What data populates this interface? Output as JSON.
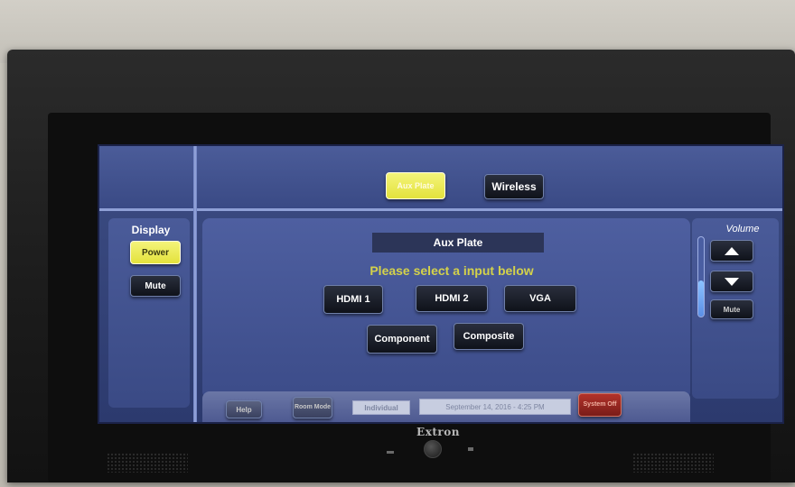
{
  "top": {
    "aux_plate_label": "Aux Plate",
    "wireless_label": "Wireless"
  },
  "left": {
    "display_label": "Display",
    "power_label": "Power",
    "mute_label": "Mute"
  },
  "main": {
    "title": "Aux Plate",
    "prompt": "Please select a input below",
    "inputs": {
      "hdmi1": "HDMI 1",
      "hdmi2": "HDMI 2",
      "vga": "VGA",
      "component": "Component",
      "composite": "Composite"
    }
  },
  "right": {
    "volume_label": "Volume",
    "volume_level": 0.45,
    "mute_label": "Mute",
    "up_icon": "triangle-up-icon",
    "down_icon": "triangle-down-icon"
  },
  "bottom": {
    "help_label": "Help",
    "room_mode_label": "Room Mode",
    "mode_value": "Individual",
    "datetime": "September 14, 2016  -  4:25 PM",
    "system_off_label": "System Off"
  },
  "device": {
    "brand": "Extron"
  },
  "colors": {
    "active_button": "#e9e84a",
    "screen_bg": "#3d4d84",
    "prompt_text": "#d4d24a",
    "system_off": "#b2322a"
  }
}
